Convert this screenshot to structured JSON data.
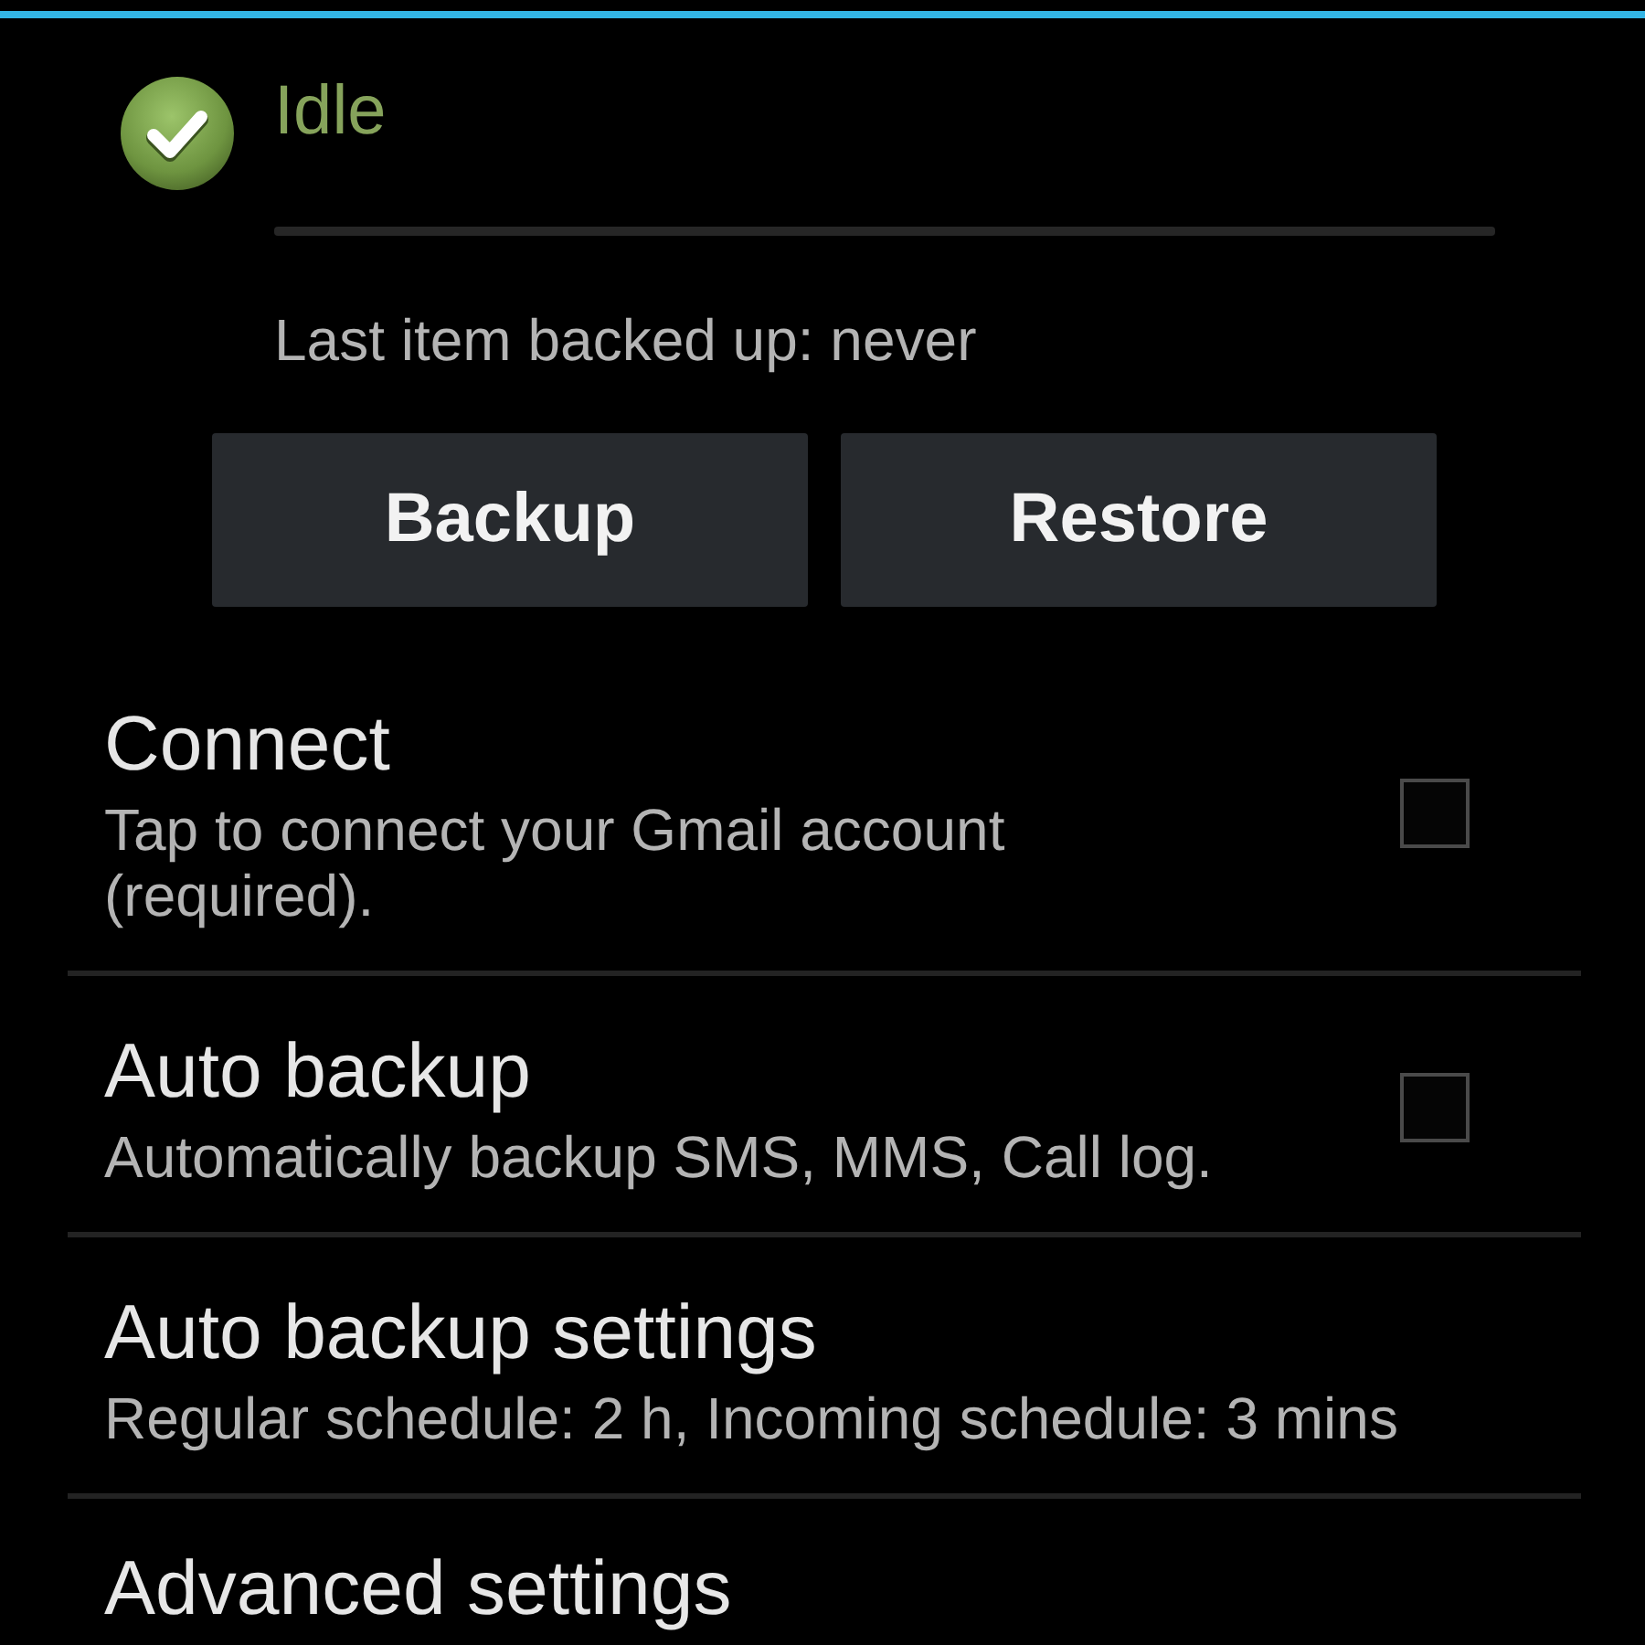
{
  "status": {
    "state": "Idle",
    "last_backup": "Last item backed up: never"
  },
  "buttons": [
    "Backup",
    "Restore"
  ],
  "preferences": [
    {
      "kind": "checkbox",
      "title": "Connect",
      "summary": "Tap to connect your Gmail account (required).",
      "checked": false
    },
    {
      "kind": "checkbox",
      "title": "Auto backup",
      "summary": "Automatically backup SMS, MMS, Call log.",
      "checked": false
    },
    {
      "kind": "plain",
      "title": "Auto backup settings",
      "summary": "Regular schedule: 2 h, Incoming schedule: 3 mins"
    },
    {
      "kind": "plain",
      "title": "Advanced settings"
    }
  ]
}
